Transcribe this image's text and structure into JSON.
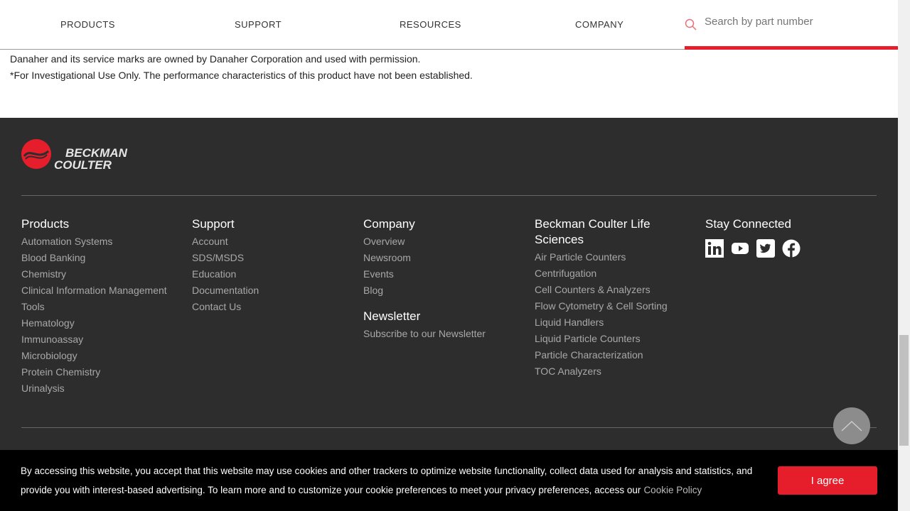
{
  "nav": {
    "items": [
      "PRODUCTS",
      "SUPPORT",
      "RESOURCES",
      "COMPANY"
    ],
    "search_placeholder": "Search by part number",
    "accent": "#e61e2b"
  },
  "notes": [
    "Danaher and its service marks are owned by Danaher Corporation and used with permission.",
    "*For Investigational Use Only. The performance characteristics of this product have not been established."
  ],
  "footer": {
    "logo_text": "BECKMAN COULTER",
    "columns": [
      {
        "title": "Products",
        "links": [
          "Automation Systems",
          "Blood Banking",
          "Chemistry",
          "Clinical Information Management",
          "Tools",
          "Hematology",
          "Immunoassay",
          "Microbiology",
          "Protein Chemistry",
          "Urinalysis"
        ]
      },
      {
        "title": "Support",
        "links": [
          "Account",
          "SDS/MSDS",
          "Education",
          "Documentation",
          "Contact Us"
        ]
      },
      {
        "title": "Company",
        "links": [
          "Overview",
          "Newsroom",
          "Events",
          "Blog"
        ],
        "title2": "Newsletter",
        "links2": [
          "Subscribe to our Newsletter"
        ]
      },
      {
        "title": "Beckman Coulter Life Sciences",
        "links": [
          "Air Particle Counters",
          "Centrifugation",
          "Cell Counters & Analyzers",
          "Flow Cytometry & Cell Sorting",
          "Liquid Handlers",
          "Liquid Particle Counters",
          "Particle Characterization",
          "TOC Analyzers"
        ]
      },
      {
        "title": "Stay Connected",
        "social": [
          "linkedin-icon",
          "youtube-icon",
          "twitter-icon",
          "facebook-icon"
        ]
      }
    ]
  },
  "cookie": {
    "text": "By accessing this website, you accept that this website may use cookies and other trackers to optimize website functionality, collect data used for analysis and statistics, and provide you with interest-based advertising. To learn more and to customize your cookie preferences to meet your privacy preferences, access our",
    "policy_link": "Cookie Policy",
    "agree": "I agree"
  }
}
